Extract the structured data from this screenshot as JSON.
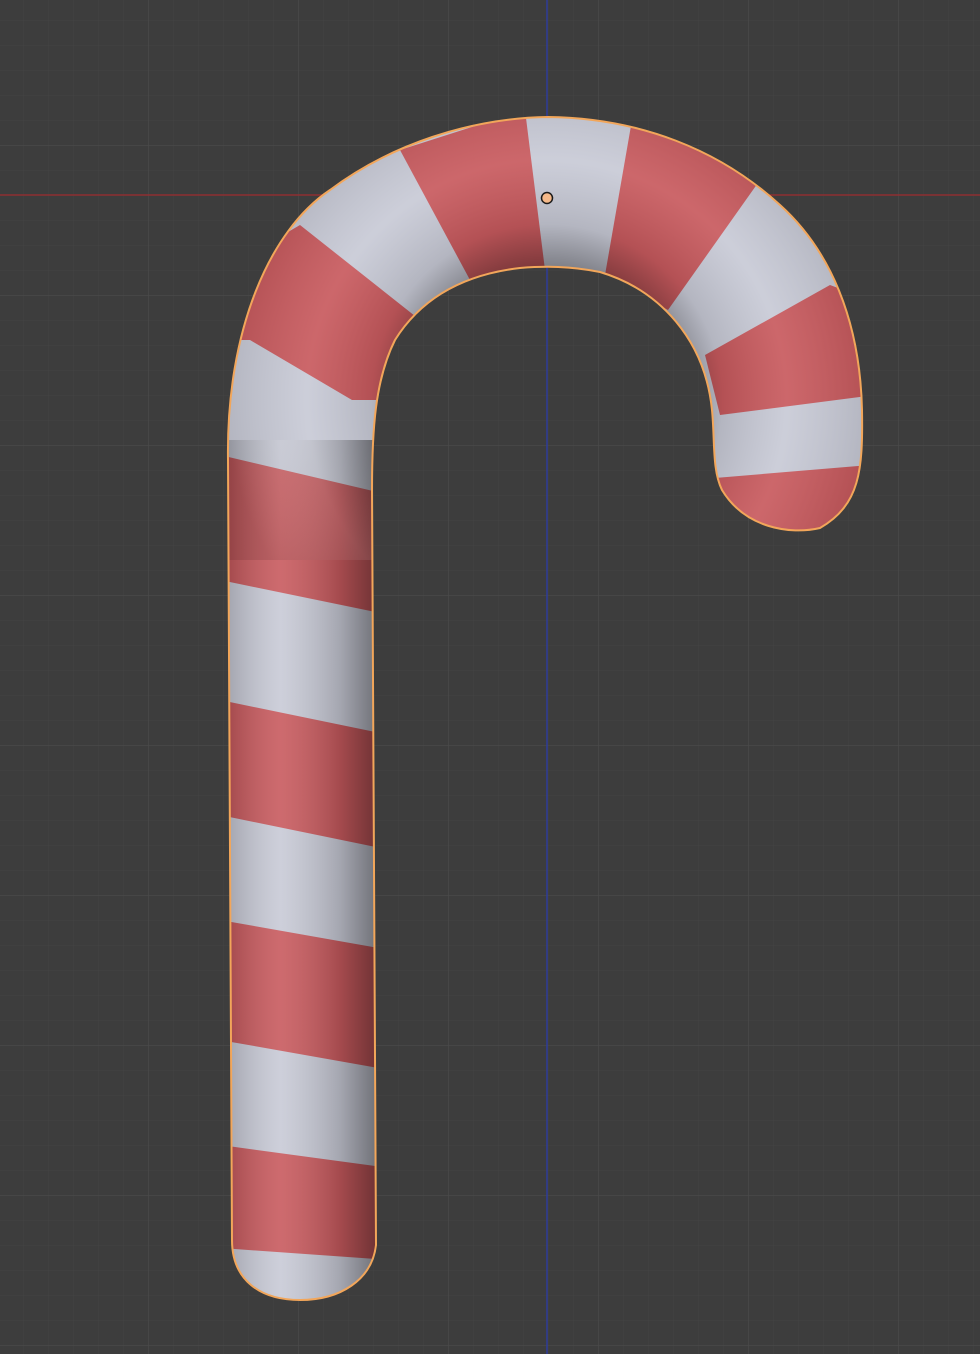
{
  "viewport": {
    "background_color": "#3d3d3d",
    "grid_minor_color": "#434343",
    "grid_major_color": "#4b4b4b",
    "x_axis_color": "#8e2f32",
    "z_axis_color": "#2f3d9a"
  },
  "object": {
    "icon": "candy-cane",
    "selected": true,
    "stripe_colors": {
      "red": "#c85a5e",
      "white": "#c8cad6"
    },
    "outline_color": "#f2a65a",
    "origin_marker_color": "#f5b98a"
  }
}
